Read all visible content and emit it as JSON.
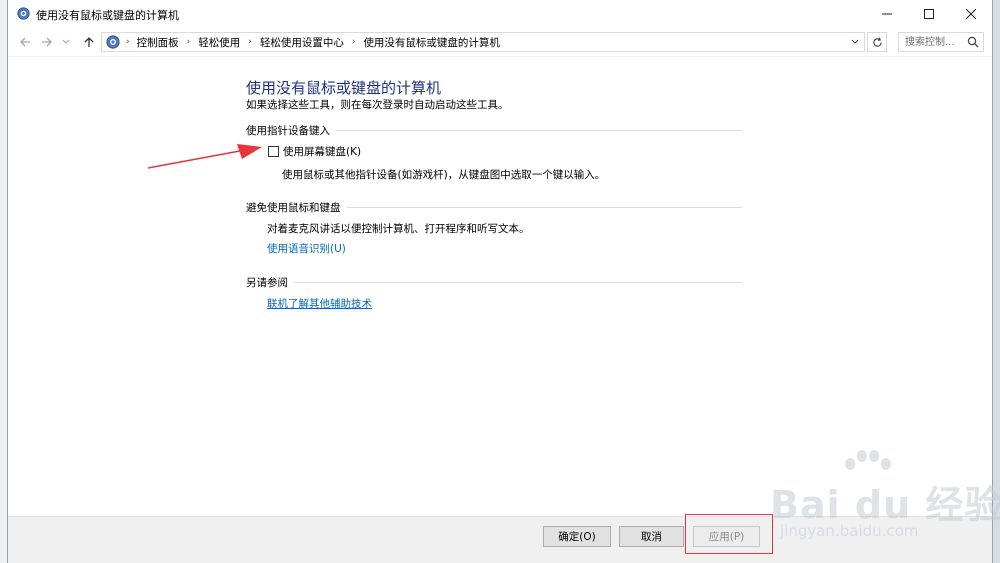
{
  "window": {
    "title": "使用没有鼠标或键盘的计算机"
  },
  "address": {
    "crumbs": [
      "控制面板",
      "轻松使用",
      "轻松使用设置中心",
      "使用没有鼠标或键盘的计算机"
    ]
  },
  "search": {
    "placeholder": "搜索控制..."
  },
  "page": {
    "title": "使用没有鼠标或键盘的计算机",
    "description": "如果选择这些工具，则在每次登录时自动启动这些工具。"
  },
  "sections": {
    "pointing": {
      "heading": "使用指针设备键入",
      "checkbox_label": "使用屏幕键盘(K)",
      "checkbox_checked": false,
      "note": "使用鼠标或其他指针设备(如游戏杆)，从键盘图中选取一个键以输入。"
    },
    "avoid": {
      "heading": "避免使用鼠标和键盘",
      "note": "对着麦克风讲话以便控制计算机、打开程序和听写文本。",
      "link": "使用语音识别(U)"
    },
    "see_also": {
      "heading": "另请参阅",
      "link": "联机了解其他辅助技术"
    }
  },
  "footer": {
    "ok_label": "确定(O)",
    "cancel_label": "取消",
    "apply_label": "应用(P)"
  },
  "watermark": {
    "main": "Bai du 经验",
    "sub": "jingyan.baidu.com"
  },
  "colors": {
    "title_blue": "#1e3287",
    "link_blue": "#0066cc",
    "annotation_red": "#e8353a"
  }
}
